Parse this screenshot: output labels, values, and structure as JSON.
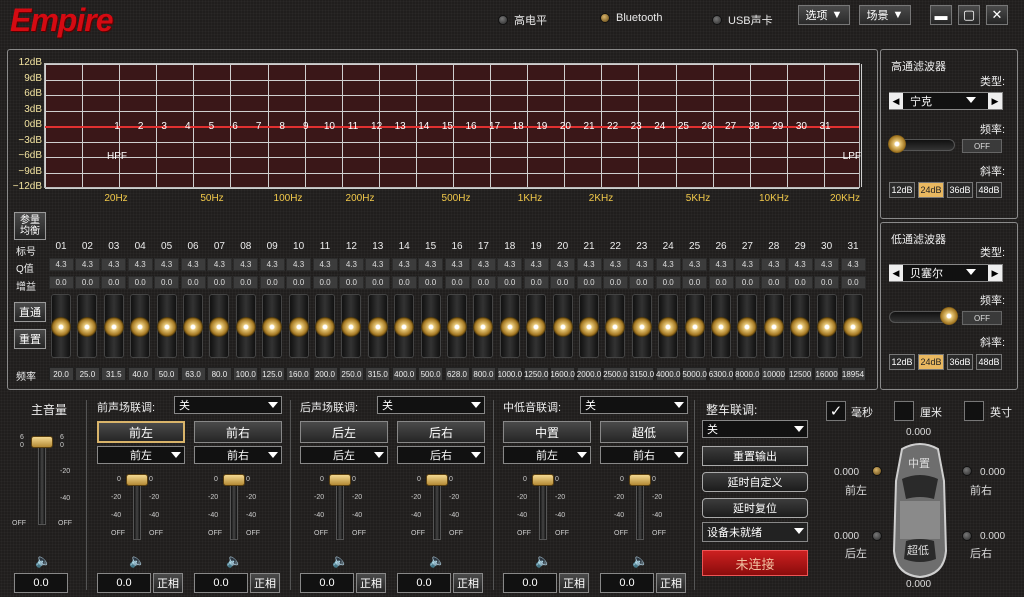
{
  "app": {
    "logo": "Empire"
  },
  "header": {
    "indicators": [
      {
        "label": "高电平",
        "on": false
      },
      {
        "label": "Bluetooth",
        "on": true
      },
      {
        "label": "USB声卡",
        "on": false
      }
    ],
    "menus": [
      "选项",
      "场景"
    ],
    "window": [
      "▬",
      "▢",
      "✕"
    ]
  },
  "eq": {
    "y_labels": [
      "12dB",
      "9dB",
      "6dB",
      "3dB",
      "0dB",
      "−3dB",
      "−6dB",
      "−9dB",
      "−12dB"
    ],
    "x_labels": [
      "20Hz",
      "50Hz",
      "100Hz",
      "200Hz",
      "500Hz",
      "1KHz",
      "2KHz",
      "5KHz",
      "10KHz",
      "20KHz"
    ],
    "hpf": "HPF",
    "lpf": "LPF",
    "mode_button": "参量\n均衡",
    "row_labels": {
      "band": "标号",
      "q": "Q值",
      "gain": "增益",
      "freq": "频率"
    },
    "bands": [
      "01",
      "02",
      "03",
      "04",
      "05",
      "06",
      "07",
      "08",
      "09",
      "10",
      "11",
      "12",
      "13",
      "14",
      "15",
      "16",
      "17",
      "18",
      "19",
      "20",
      "21",
      "22",
      "23",
      "24",
      "25",
      "26",
      "27",
      "28",
      "29",
      "30",
      "31"
    ],
    "band_markers": [
      "1",
      "2",
      "3",
      "4",
      "5",
      "6",
      "7",
      "8",
      "9",
      "10",
      "11",
      "12",
      "13",
      "14",
      "15",
      "16",
      "17",
      "18",
      "19",
      "20",
      "21",
      "22",
      "23",
      "24",
      "25",
      "26",
      "27",
      "28",
      "29",
      "30",
      "31"
    ],
    "q_value": "4.3",
    "gain_value": "0.0",
    "freqs": [
      "20.0",
      "25.0",
      "31.5",
      "40.0",
      "50.0",
      "63.0",
      "80.0",
      "100.0",
      "125.0",
      "160.0",
      "200.0",
      "250.0",
      "315.0",
      "400.0",
      "500.0",
      "628.0",
      "800.0",
      "1000.0",
      "1250.0",
      "1600.0",
      "2000.0",
      "2500.0",
      "3150.0",
      "4000.0",
      "5000.0",
      "6300.0",
      "8000.0",
      "10000",
      "12500",
      "16000",
      "18954"
    ],
    "bypass_label": "直通",
    "reset_label": "重置"
  },
  "hpf_panel": {
    "title": "高通滤波器",
    "type_label": "类型:",
    "type_value": "宁克",
    "freq_label": "频率:",
    "off_label": "OFF",
    "slope_label": "斜率:",
    "slopes": [
      "12dB",
      "24dB",
      "36dB",
      "48dB"
    ],
    "active_slope": "24dB"
  },
  "lpf_panel": {
    "title": "低通滤波器",
    "type_label": "类型:",
    "type_value": "贝塞尔",
    "freq_label": "频率:",
    "off_label": "OFF",
    "slope_label": "斜率:",
    "slopes": [
      "12dB",
      "24dB",
      "36dB",
      "48dB"
    ],
    "active_slope": "24dB"
  },
  "master": {
    "label": "主音量",
    "value": "0.0",
    "ticks": [
      "6",
      "0",
      "-20",
      "-40",
      "OFF"
    ]
  },
  "groups": [
    {
      "label": "前声场联调:",
      "link": "关",
      "channels": [
        {
          "name": "前左",
          "sel": "前左",
          "value": "0.0",
          "active": true
        },
        {
          "name": "前右",
          "sel": "前右",
          "value": "0.0",
          "active": false
        }
      ]
    },
    {
      "label": "后声场联调:",
      "link": "关",
      "channels": [
        {
          "name": "后左",
          "sel": "后左",
          "value": "0.0",
          "active": false
        },
        {
          "name": "后右",
          "sel": "后右",
          "value": "0.0",
          "active": false
        }
      ]
    },
    {
      "label": "中低音联调:",
      "link": "关",
      "channels": [
        {
          "name": "中置",
          "sel": "前左",
          "value": "0.0",
          "active": false
        },
        {
          "name": "超低",
          "sel": "前右",
          "value": "0.0",
          "active": false
        }
      ]
    }
  ],
  "fader_ticks": [
    "0",
    "-20",
    "-40",
    "OFF"
  ],
  "phase_label": "正相",
  "car_link": {
    "label": "整车联调:",
    "value": "关",
    "buttons": [
      "重置输出",
      "延时自定义",
      "延时复位"
    ],
    "device": "设备未就绪",
    "connect": "未连接"
  },
  "units": [
    {
      "label": "毫秒",
      "checked": true
    },
    {
      "label": "厘米",
      "checked": false
    },
    {
      "label": "英寸",
      "checked": false
    }
  ],
  "delay": {
    "top": "0.000",
    "front_left_val": "0.000",
    "front_right_val": "0.000",
    "rear_left_val": "0.000",
    "rear_right_val": "0.000",
    "bottom": "0.000",
    "front_left": "前左",
    "front_right": "前右",
    "rear_left": "后左",
    "rear_right": "后右",
    "center": "中置",
    "sub": "超低"
  },
  "colors": {
    "accent": "#e9b860",
    "curve": "#e03030",
    "connect": "#b81818"
  }
}
